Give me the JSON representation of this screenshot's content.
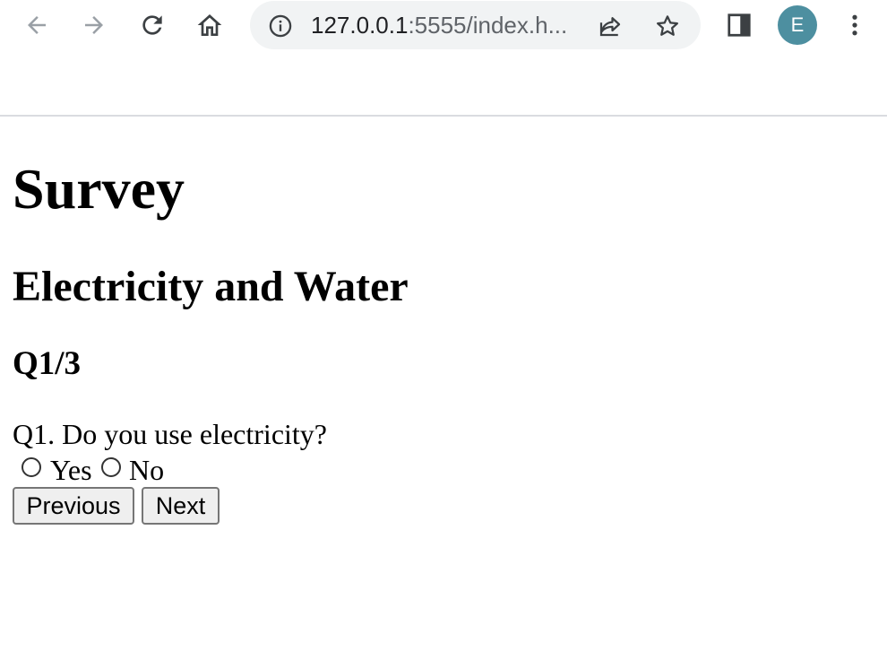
{
  "browser": {
    "url_host": "127.0.0.1",
    "url_path": ":5555/index.h...",
    "profile_initial": "E",
    "icons": {
      "back": "arrow-left-icon",
      "forward": "arrow-right-icon",
      "reload": "reload-icon",
      "home": "home-icon",
      "site_info": "info-icon",
      "share": "share-icon",
      "bookmark": "star-icon",
      "side_panel": "side-panel-icon",
      "menu": "more-vertical-icon"
    },
    "colors": {
      "omnibox_bg": "#f1f3f4",
      "avatar_bg": "#4d8fa0",
      "disabled_icon": "#9aa0a6",
      "icon": "#3c4043"
    }
  },
  "page": {
    "title": "Survey",
    "section": "Electricity and Water",
    "progress": "Q1/3",
    "question": "Q1. Do you use electricity?",
    "options": [
      {
        "label": "Yes",
        "selected": false
      },
      {
        "label": "No",
        "selected": false
      }
    ],
    "buttons": {
      "previous": "Previous",
      "next": "Next"
    }
  }
}
